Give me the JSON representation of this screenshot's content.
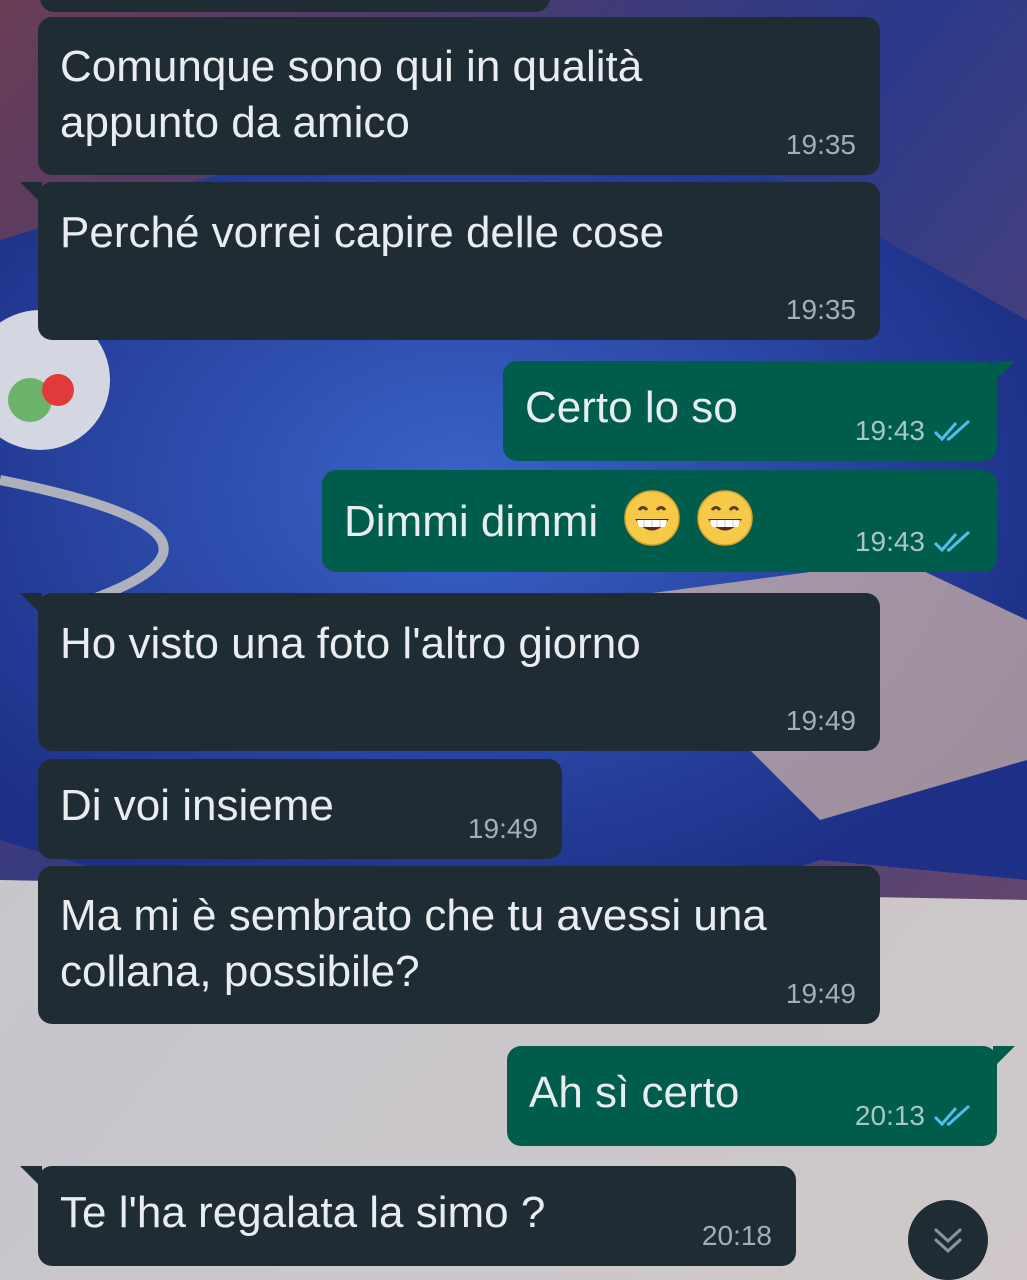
{
  "colors": {
    "incoming_bubble": "#202c33",
    "outgoing_bubble": "#005c4b",
    "text": "#e9edef",
    "read_ticks": "#53bdeb"
  },
  "messages": [
    {
      "direction": "incoming",
      "lines": [
        "Comunque sono qui in qualità",
        "appunto da amico"
      ],
      "time": "19:35"
    },
    {
      "direction": "incoming",
      "lines": [
        "Perché vorrei capire delle cose"
      ],
      "time": "19:35"
    },
    {
      "direction": "outgoing",
      "lines": [
        "Certo lo so"
      ],
      "time": "19:43",
      "status": "read-double-check-icon"
    },
    {
      "direction": "outgoing",
      "lines": [
        "Dimmi dimmi"
      ],
      "emoji": [
        "grinning-face-icon",
        "grinning-face-icon"
      ],
      "time": "19:43",
      "status": "read-double-check-icon"
    },
    {
      "direction": "incoming",
      "lines": [
        "Ho visto una foto l'altro giorno"
      ],
      "time": "19:49"
    },
    {
      "direction": "incoming",
      "lines": [
        "Di voi insieme"
      ],
      "time": "19:49"
    },
    {
      "direction": "incoming",
      "lines": [
        "Ma mi è sembrato che tu avessi una",
        "collana, possibile?"
      ],
      "time": "19:49"
    },
    {
      "direction": "outgoing",
      "lines": [
        "Ah sì certo"
      ],
      "time": "20:13",
      "status": "read-double-check-icon"
    },
    {
      "direction": "incoming",
      "lines": [
        "Te l'ha regalata la simo ?"
      ],
      "time": "20:18"
    }
  ],
  "scroll_button_icon": "double-chevron-down-icon"
}
